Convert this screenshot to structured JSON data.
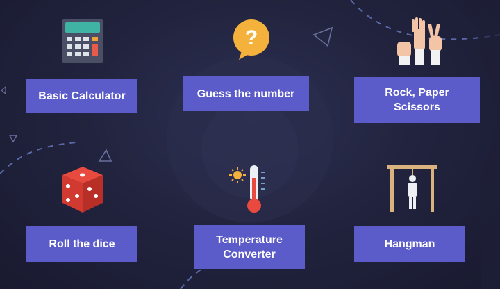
{
  "cards": [
    {
      "id": "basic-calculator",
      "label": "Basic Calculator",
      "icon": "calculator-icon"
    },
    {
      "id": "guess-the-number",
      "label": "Guess the number",
      "icon": "question-bubble-icon"
    },
    {
      "id": "rock-paper-scissors",
      "label": "Rock, Paper\nScissors",
      "icon": "hands-icon"
    },
    {
      "id": "roll-the-dice",
      "label": "Roll the dice",
      "icon": "dice-icon"
    },
    {
      "id": "temperature-converter",
      "label": "Temperature\nConverter",
      "icon": "thermometer-icon"
    },
    {
      "id": "hangman",
      "label": "Hangman",
      "icon": "gallows-icon"
    }
  ],
  "colors": {
    "background": "#22243f",
    "label_bg": "#5b5bc9",
    "label_text": "#ffffff"
  }
}
